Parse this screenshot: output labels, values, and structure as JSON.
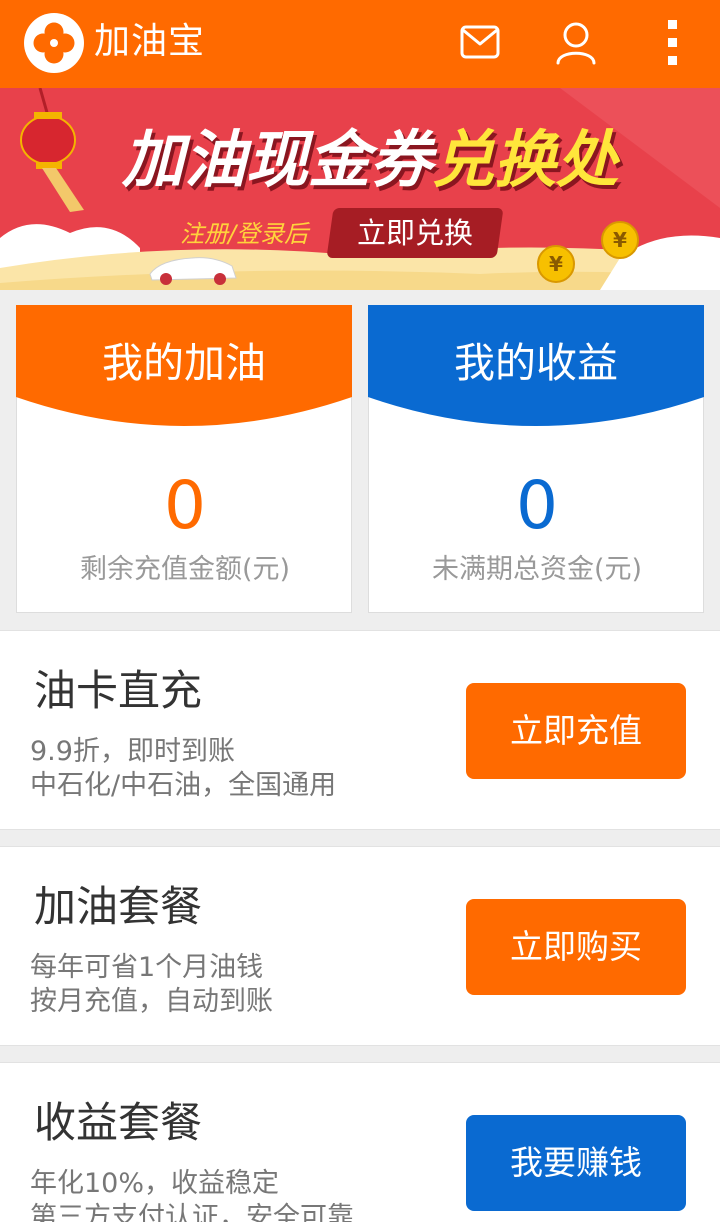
{
  "app": {
    "title": "加油宝"
  },
  "colors": {
    "brand_orange": "#ff6a00",
    "blue": "#0a6ad1",
    "banner_red": "#e8414b"
  },
  "banner": {
    "title_white": "加油现金券",
    "title_yellow": "兑换处",
    "subtitle": "注册/登录后",
    "button_label": "立即兑换"
  },
  "cards": [
    {
      "title": "我的加油",
      "value": "0",
      "label": "剩余充值金额(元)"
    },
    {
      "title": "我的收益",
      "value": "0",
      "label": "未满期总资金(元)"
    }
  ],
  "products": [
    {
      "title": "油卡直充",
      "desc1": "9.9折，即时到账",
      "desc2": "中石化/中石油，全国通用",
      "button_label": "立即充值"
    },
    {
      "title": "加油套餐",
      "desc1": "每年可省1个月油钱",
      "desc2": "按月充值，自动到账",
      "button_label": "立即购买"
    },
    {
      "title": "收益套餐",
      "desc1": "年化10%，收益稳定",
      "desc2": "第三方支付认证，安全可靠",
      "button_label": "我要赚钱"
    }
  ]
}
